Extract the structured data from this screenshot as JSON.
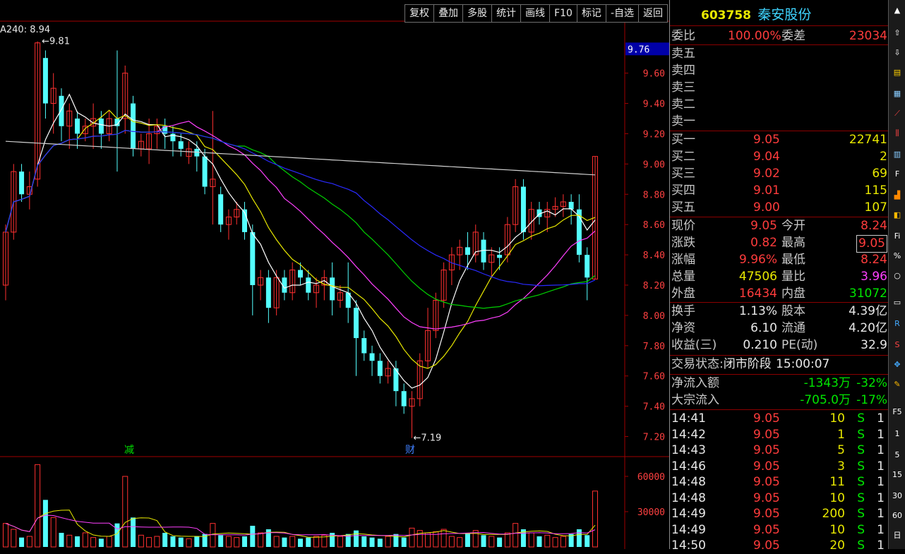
{
  "toolbar": [
    "复权",
    "叠加",
    "多股",
    "统计",
    "画线",
    "F10",
    "标记",
    "-自选",
    "返回"
  ],
  "ma_label": "A240: 8.94",
  "price_axis": [
    "9.60",
    "9.40",
    "9.20",
    "9.00",
    "8.80",
    "8.60",
    "8.40",
    "8.20",
    "8.00",
    "7.80",
    "7.60",
    "7.40",
    "7.20"
  ],
  "price_tag": "9.76",
  "vol_axis": [
    "60000",
    "30000"
  ],
  "annotations": {
    "high": "9.81",
    "low": "7.19",
    "mark_jian": "减",
    "mark_cai": "财"
  },
  "stock": {
    "code": "603758",
    "name": "秦安股份"
  },
  "weibi": {
    "label": "委比",
    "value": "100.00%",
    "label2": "委差",
    "value2": "23034"
  },
  "sell_orders": [
    {
      "label": "卖五"
    },
    {
      "label": "卖四"
    },
    {
      "label": "卖三"
    },
    {
      "label": "卖二"
    },
    {
      "label": "卖一"
    }
  ],
  "buy_orders": [
    {
      "label": "买一",
      "price": "9.05",
      "vol": "22741"
    },
    {
      "label": "买二",
      "price": "9.04",
      "vol": "2"
    },
    {
      "label": "买三",
      "price": "9.02",
      "vol": "69"
    },
    {
      "label": "买四",
      "price": "9.01",
      "vol": "115"
    },
    {
      "label": "买五",
      "price": "9.00",
      "vol": "107"
    }
  ],
  "quote": [
    {
      "l1": "现价",
      "v1": "9.05",
      "c1": "red",
      "l2": "今开",
      "v2": "8.24",
      "c2": "red"
    },
    {
      "l1": "涨跌",
      "v1": "0.82",
      "c1": "red",
      "l2": "最高",
      "v2": "9.05",
      "c2": "red"
    },
    {
      "l1": "涨幅",
      "v1": "9.96%",
      "c1": "red",
      "l2": "最低",
      "v2": "8.24",
      "c2": "red"
    },
    {
      "l1": "总量",
      "v1": "47506",
      "c1": "yel",
      "l2": "量比",
      "v2": "3.96",
      "c2": "mag"
    },
    {
      "l1": "外盘",
      "v1": "16434",
      "c1": "red",
      "l2": "内盘",
      "v2": "31072",
      "c2": "grn"
    }
  ],
  "fundamentals": [
    {
      "l1": "换手",
      "v1": "1.13%",
      "l2": "股本",
      "v2": "4.39亿"
    },
    {
      "l1": "净资",
      "v1": "6.10",
      "l2": "流通",
      "v2": "4.20亿"
    },
    {
      "l1": "收益(三)",
      "v1": "0.210",
      "l2": "PE(动)",
      "v2": "32.9"
    }
  ],
  "trade_status": {
    "label": "交易状态:",
    "value": "闭市阶段",
    "time": "15:00:07"
  },
  "flows": [
    {
      "label": "净流入额",
      "value": "-1343万",
      "pct": "-32%"
    },
    {
      "label": "大宗流入",
      "value": "-705.0万",
      "pct": "-17%"
    }
  ],
  "ticks": [
    {
      "time": "14:41",
      "price": "9.05",
      "vol": "10",
      "side": "S",
      "n": "1"
    },
    {
      "time": "14:42",
      "price": "9.05",
      "vol": "1",
      "side": "S",
      "n": "1"
    },
    {
      "time": "14:43",
      "price": "9.05",
      "vol": "5",
      "side": "S",
      "n": "1"
    },
    {
      "time": "14:46",
      "price": "9.05",
      "vol": "3",
      "side": "S",
      "n": "1"
    },
    {
      "time": "14:48",
      "price": "9.05",
      "vol": "11",
      "side": "S",
      "n": "1"
    },
    {
      "time": "14:48",
      "price": "9.05",
      "vol": "10",
      "side": "S",
      "n": "1"
    },
    {
      "time": "14:49",
      "price": "9.05",
      "vol": "200",
      "side": "S",
      "n": "1"
    },
    {
      "time": "14:49",
      "price": "9.05",
      "vol": "10",
      "side": "S",
      "n": "1"
    },
    {
      "time": "14:50",
      "price": "9.05",
      "vol": "20",
      "side": "S",
      "n": "1"
    }
  ],
  "chart_data": {
    "type": "candlestick",
    "ylim": [
      7.1,
      9.85
    ],
    "candles": [
      [
        8.2,
        8.55,
        8.1,
        8.6
      ],
      [
        8.55,
        8.95,
        8.5,
        9.0
      ],
      [
        8.95,
        8.8,
        8.75,
        9.0
      ],
      [
        8.8,
        8.85,
        8.7,
        8.95
      ],
      [
        8.9,
        9.8,
        8.85,
        9.81
      ],
      [
        9.7,
        9.4,
        9.3,
        9.75
      ],
      [
        9.4,
        9.5,
        9.2,
        9.6
      ],
      [
        9.45,
        9.25,
        9.15,
        9.5
      ],
      [
        9.25,
        9.35,
        9.1,
        9.4
      ],
      [
        9.3,
        9.2,
        9.1,
        9.35
      ],
      [
        9.2,
        9.25,
        9.15,
        9.3
      ],
      [
        9.25,
        9.3,
        9.1,
        9.4
      ],
      [
        9.3,
        9.2,
        9.1,
        9.35
      ],
      [
        9.2,
        9.3,
        9.15,
        9.35
      ],
      [
        9.3,
        9.25,
        8.95,
        9.75
      ],
      [
        9.3,
        9.6,
        9.2,
        9.65
      ],
      [
        9.4,
        9.1,
        9.05,
        9.45
      ],
      [
        9.1,
        9.15,
        9.05,
        9.2
      ],
      [
        9.1,
        9.2,
        9.0,
        9.3
      ],
      [
        9.2,
        9.25,
        9.1,
        9.3
      ],
      [
        9.25,
        9.2,
        9.1,
        9.3
      ],
      [
        9.2,
        9.15,
        9.05,
        9.25
      ],
      [
        9.15,
        9.1,
        9.05,
        9.2
      ],
      [
        9.05,
        9.1,
        9.0,
        9.15
      ],
      [
        9.1,
        9.05,
        8.95,
        9.15
      ],
      [
        9.05,
        8.85,
        8.8,
        9.1
      ],
      [
        8.85,
        8.9,
        8.6,
        9.35
      ],
      [
        8.8,
        8.6,
        8.55,
        8.85
      ],
      [
        8.6,
        8.65,
        8.5,
        8.7
      ],
      [
        8.65,
        8.7,
        8.6,
        8.75
      ],
      [
        8.7,
        8.55,
        8.5,
        8.75
      ],
      [
        8.55,
        8.2,
        8.0,
        8.6
      ],
      [
        8.2,
        8.25,
        8.1,
        8.3
      ],
      [
        8.25,
        8.05,
        7.95,
        8.3
      ],
      [
        8.05,
        8.25,
        8.0,
        8.3
      ],
      [
        8.25,
        8.15,
        8.1,
        8.3
      ],
      [
        8.15,
        8.3,
        8.1,
        8.35
      ],
      [
        8.3,
        8.25,
        8.2,
        8.35
      ],
      [
        8.25,
        8.15,
        8.1,
        8.3
      ],
      [
        8.15,
        8.2,
        8.05,
        8.25
      ],
      [
        8.2,
        8.25,
        8.1,
        8.3
      ],
      [
        8.25,
        8.1,
        8.0,
        8.35
      ],
      [
        8.1,
        8.15,
        8.05,
        8.2
      ],
      [
        8.15,
        8.05,
        7.95,
        8.35
      ],
      [
        8.05,
        7.85,
        7.6,
        8.1
      ],
      [
        7.85,
        7.75,
        7.7,
        7.9
      ],
      [
        7.75,
        7.7,
        7.6,
        7.8
      ],
      [
        7.7,
        7.6,
        7.55,
        7.75
      ],
      [
        7.6,
        7.65,
        7.55,
        7.7
      ],
      [
        7.65,
        7.5,
        7.4,
        7.7
      ],
      [
        7.5,
        7.4,
        7.35,
        7.55
      ],
      [
        7.4,
        7.45,
        7.19,
        7.5
      ],
      [
        7.45,
        7.7,
        7.4,
        7.75
      ],
      [
        7.7,
        7.9,
        7.65,
        8.05
      ],
      [
        7.9,
        8.1,
        7.85,
        8.15
      ],
      [
        8.1,
        8.3,
        8.05,
        8.35
      ],
      [
        8.3,
        8.4,
        8.2,
        8.45
      ],
      [
        8.4,
        8.45,
        8.3,
        8.5
      ],
      [
        8.45,
        8.4,
        8.3,
        8.55
      ],
      [
        8.4,
        8.55,
        8.35,
        8.6
      ],
      [
        8.5,
        8.35,
        8.3,
        8.55
      ],
      [
        8.35,
        8.4,
        8.25,
        8.45
      ],
      [
        8.4,
        8.38,
        8.3,
        8.45
      ],
      [
        8.4,
        8.6,
        8.35,
        8.65
      ],
      [
        8.6,
        8.85,
        8.55,
        8.9
      ],
      [
        8.85,
        8.55,
        8.5,
        8.9
      ],
      [
        8.55,
        8.7,
        8.5,
        8.75
      ],
      [
        8.7,
        8.65,
        8.6,
        8.75
      ],
      [
        8.65,
        8.7,
        8.55,
        8.75
      ],
      [
        8.7,
        8.72,
        8.65,
        8.78
      ],
      [
        8.72,
        8.75,
        8.65,
        8.8
      ],
      [
        8.75,
        8.7,
        8.6,
        8.8
      ],
      [
        8.7,
        8.4,
        8.35,
        8.8
      ],
      [
        8.4,
        8.25,
        8.1,
        8.45
      ],
      [
        8.24,
        9.05,
        8.24,
        9.05
      ]
    ],
    "volumes": [
      20000,
      15000,
      8000,
      9000,
      70000,
      40000,
      25000,
      12000,
      10000,
      9000,
      12000,
      8000,
      7000,
      9000,
      20000,
      60000,
      25000,
      10000,
      8000,
      9000,
      12000,
      9000,
      8000,
      7000,
      9000,
      11000,
      20000,
      10000,
      9000,
      8000,
      9000,
      18000,
      12000,
      15000,
      9000,
      8000,
      9000,
      7000,
      8000,
      9000,
      10000,
      12000,
      9000,
      11000,
      14000,
      9000,
      8000,
      7000,
      9000,
      11000,
      8000,
      16000,
      14000,
      12000,
      13000,
      15000,
      9000,
      8000,
      12000,
      14000,
      10000,
      9000,
      8000,
      12000,
      20000,
      15000,
      12000,
      9000,
      10000,
      8000,
      9000,
      11000,
      15000,
      10000,
      47506
    ]
  }
}
